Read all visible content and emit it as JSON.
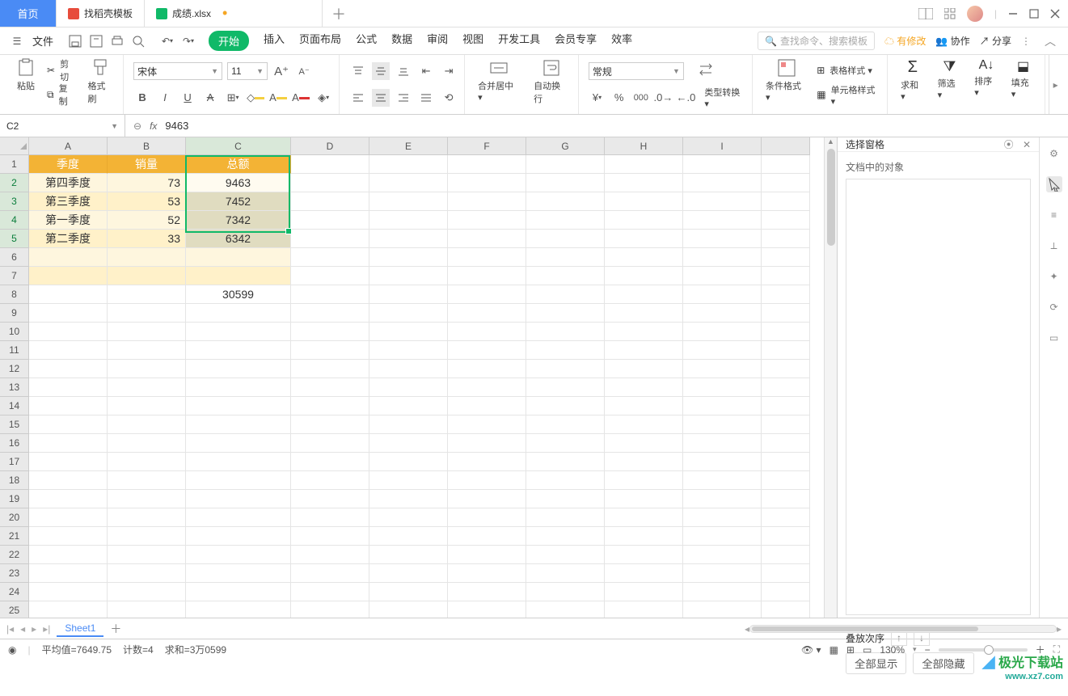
{
  "tabs": {
    "home": "首页",
    "template": "找稻壳模板",
    "file": "成绩.xlsx"
  },
  "menubar": {
    "file": "文件",
    "items": [
      "开始",
      "插入",
      "页面布局",
      "公式",
      "数据",
      "审阅",
      "视图",
      "开发工具",
      "会员专享",
      "效率"
    ],
    "search_placeholder": "查找命令、搜索模板",
    "changes": "有修改",
    "collab": "协作",
    "share": "分享"
  },
  "ribbon": {
    "paste": "粘贴",
    "cut": "剪切",
    "copy": "复制",
    "format_painter": "格式刷",
    "font_name": "宋体",
    "font_size": "11",
    "merge": "合并居中",
    "wrap": "自动换行",
    "number_format": "常规",
    "type_convert": "类型转换",
    "cond_format": "条件格式",
    "table_style": "表格样式",
    "cell_style": "单元格样式",
    "sum": "求和",
    "filter": "筛选",
    "sort": "排序",
    "fill": "填充"
  },
  "namebox": "C2",
  "formula_value": "9463",
  "columns": {
    "widths": {
      "A": 97,
      "B": 97,
      "C": 130,
      "D": 97,
      "E": 97,
      "F": 97,
      "G": 97,
      "H": 97,
      "I": 97
    },
    "labels": [
      "A",
      "B",
      "C",
      "D",
      "E",
      "F",
      "G",
      "H",
      "I"
    ]
  },
  "headers": {
    "A": "季度",
    "B": "销量",
    "C": "总额"
  },
  "rows": [
    {
      "A": "第四季度",
      "B": "73",
      "C": "9463"
    },
    {
      "A": "第三季度",
      "B": "53",
      "C": "7452"
    },
    {
      "A": "第一季度",
      "B": "52",
      "C": "7342"
    },
    {
      "A": "第二季度",
      "B": "33",
      "C": "6342"
    }
  ],
  "sum_cell": {
    "row": 8,
    "col": "C",
    "value": "30599"
  },
  "total_rows": 26,
  "rpanel": {
    "title": "选择窗格",
    "subtitle": "文档中的对象",
    "stack_order": "叠放次序",
    "show_all": "全部显示",
    "hide_all": "全部隐藏"
  },
  "sheet_tab": "Sheet1",
  "status": {
    "avg": "平均值=7649.75",
    "count": "计数=4",
    "sum": "求和=3万0599",
    "zoom": "130%"
  },
  "watermark": {
    "l1": "极光下载站",
    "l2": "www.xz7.com"
  }
}
